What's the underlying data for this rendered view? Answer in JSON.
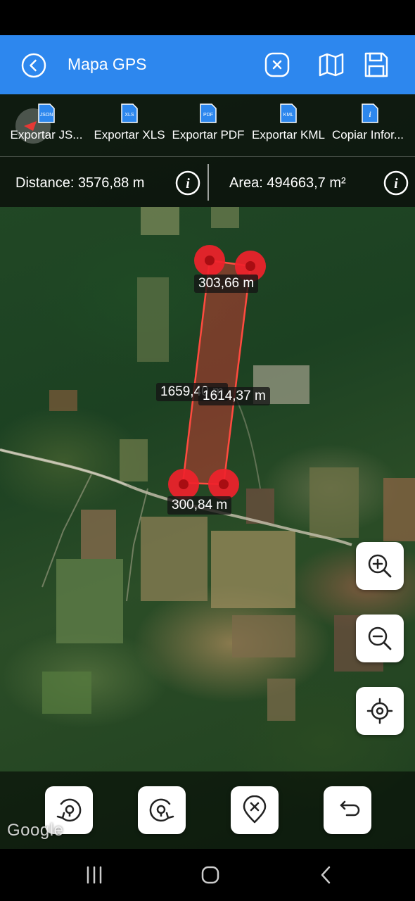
{
  "app_bar": {
    "title": "Mapa GPS",
    "accent_color": "#2d87ee",
    "icons": [
      "chevron-left-icon",
      "clear-circle-icon",
      "map-icon",
      "save-icon"
    ]
  },
  "export_bar": {
    "items": [
      {
        "badge": "JSON",
        "label": "Exportar JS..."
      },
      {
        "badge": "XLS",
        "label": "Exportar XLS"
      },
      {
        "badge": "PDF",
        "label": "Exportar PDF"
      },
      {
        "badge": "KML",
        "label": "Exportar KML"
      },
      {
        "badge": "i",
        "label": "Copiar Infor..."
      }
    ]
  },
  "metrics": {
    "distance": "Distance: 3576,88 m",
    "area": "Area: 494663,7 m²"
  },
  "map": {
    "segment_labels": {
      "top": "303,66 m",
      "left": "1659,40 m",
      "right": "1614,37 m",
      "bottom": "300,84 m"
    },
    "polygon_color": "#e53935",
    "marker_color": "#f0222b",
    "attribution": "Google"
  },
  "map_controls": [
    "zoom-in-icon",
    "zoom-out-icon",
    "my-location-icon"
  ],
  "bottom_actions": [
    "rotate-left-icon",
    "rotate-right-icon",
    "remove-point-icon",
    "undo-icon"
  ]
}
